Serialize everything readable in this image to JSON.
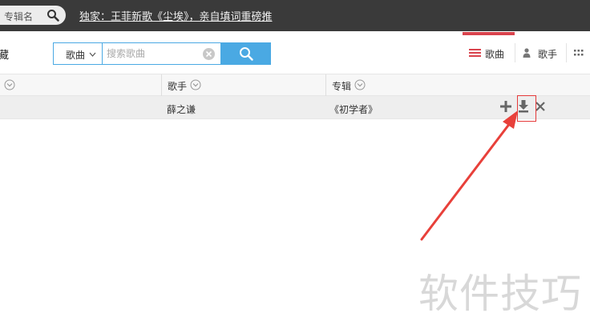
{
  "topbar": {
    "search_text": "专辑名",
    "search_icon": "search-icon",
    "news_link": "独家：王菲新歌《尘埃》，亲自填词重磅推"
  },
  "toolbar": {
    "left_cut_label": "藏",
    "type_select": {
      "selected": "歌曲",
      "icon": "chevron-down-icon"
    },
    "search": {
      "placeholder": "搜索歌曲",
      "value": ""
    },
    "tabs": [
      {
        "label": "歌曲",
        "icon": "list-icon",
        "active": true
      },
      {
        "label": "歌手",
        "icon": "person-icon",
        "active": false
      }
    ],
    "more_icon": "grid-icon",
    "accent_color": "#4aa9e3",
    "active_tab_color": "#d9434d"
  },
  "table": {
    "columns": [
      {
        "label": ""
      },
      {
        "label": "歌手"
      },
      {
        "label": "专辑"
      }
    ],
    "rows": [
      {
        "singer": "薛之谦",
        "album": "《初学者》",
        "actions": [
          "add-icon",
          "download-icon",
          "remove-icon"
        ]
      }
    ]
  },
  "annotation": {
    "highlight_color": "#e53a3a",
    "target": "download-icon"
  },
  "watermark": "软件技巧"
}
